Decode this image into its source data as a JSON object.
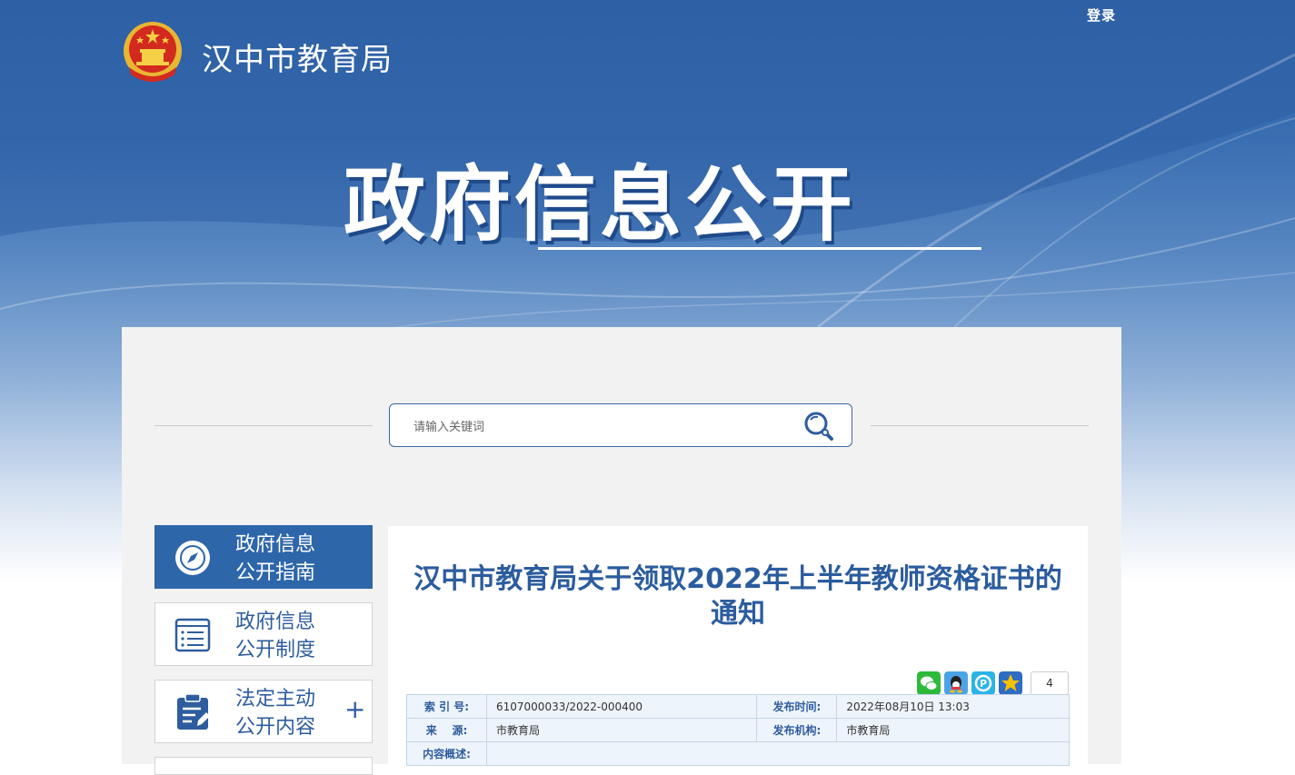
{
  "header": {
    "login_label": "登录",
    "site_name": "汉中市教育局",
    "hero_title": "政府信息公开"
  },
  "search": {
    "placeholder": "请输入关键词"
  },
  "sidebar": {
    "items": [
      {
        "line1": "政府信息",
        "line2": "公开指南",
        "icon": "compass-icon",
        "active": true
      },
      {
        "line1": "政府信息",
        "line2": "公开制度",
        "icon": "document-list-icon",
        "active": false
      },
      {
        "line1": "法定主动",
        "line2": "公开内容",
        "icon": "clipboard-icon",
        "active": false,
        "expand": "+"
      }
    ]
  },
  "article": {
    "title": "汉中市教育局关于领取2022年上半年教师资格证书的通知",
    "share_count": "4",
    "meta": {
      "index_label": "索 引 号:",
      "index_value": "6107000033/2022-000400",
      "publish_time_label": "发布时间:",
      "publish_time_value": "2022年08月10日 13:03",
      "source_label": "来    源:",
      "source_value": "市教育局",
      "publisher_label": "发布机构:",
      "publisher_value": "市教育局",
      "summary_label": "内容概述:",
      "summary_value": ""
    }
  },
  "colors": {
    "brand_blue": "#2e66aa",
    "title_blue": "#2b5c9e"
  }
}
